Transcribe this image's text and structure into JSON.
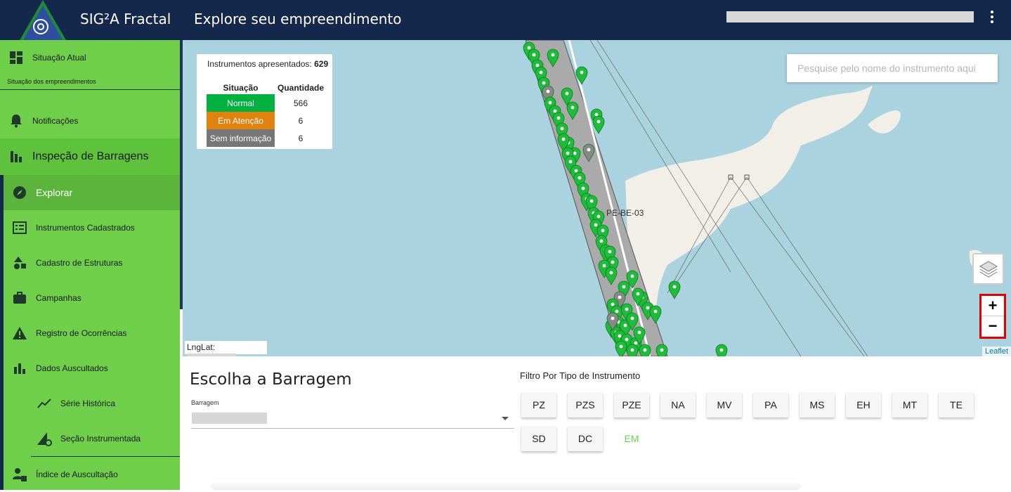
{
  "header": {
    "app_title": "SIG²A Fractal",
    "page_title": "Explore seu empreendimento",
    "menu_icon": "more-vert-icon"
  },
  "sidebar": {
    "situacao_atual": "Situação Atual",
    "situacao_sub": "Situação dos empreendimentos",
    "notificacoes": "Notificações",
    "inspecao": "Inspeção de Barragens",
    "items": [
      {
        "label": "Explorar",
        "icon": "compass-icon"
      },
      {
        "label": "Instrumentos Cadastrados",
        "icon": "instrument-list-icon"
      },
      {
        "label": "Cadastro de Estruturas",
        "icon": "shapes-icon"
      },
      {
        "label": "Campanhas",
        "icon": "briefcase-icon"
      },
      {
        "label": "Registro de Ocorrências",
        "icon": "warning-icon"
      },
      {
        "label": "Dados Auscultados",
        "icon": "bar-chart-icon"
      },
      {
        "label": "Série Histórica",
        "icon": "line-chart-icon"
      },
      {
        "label": "Seção Instrumentada",
        "icon": "section-gear-icon"
      },
      {
        "label": "Índice de Auscultação",
        "icon": "people-settings-icon"
      }
    ]
  },
  "map": {
    "legend": {
      "title": "Instrumentos apresentados:",
      "total": "629",
      "col_status": "Situação",
      "col_qty": "Quantidade",
      "rows": [
        {
          "status": "Normal",
          "qty": "566",
          "color": "#00b140"
        },
        {
          "status": "Em Atenção",
          "qty": "6",
          "color": "#e0820e"
        },
        {
          "status": "Sem informação",
          "qty": "6",
          "color": "#777777"
        }
      ]
    },
    "search_placeholder": "Pesquise pelo nome do instrumento aqui",
    "structure_label": "PE-BE-03",
    "zoom_in": "+",
    "zoom_out": "−",
    "attribution": "Leaflet",
    "lnglat_label": "LngLat:"
  },
  "dam": {
    "title": "Escolha a Barragem",
    "label": "Barragem"
  },
  "filter": {
    "title": "Filtro Por Tipo de Instrumento",
    "chips": [
      "PZ",
      "PZS",
      "PZE",
      "NA",
      "MV",
      "PA",
      "MS",
      "EH",
      "MT",
      "TE",
      "SD",
      "DC",
      "EM"
    ]
  }
}
